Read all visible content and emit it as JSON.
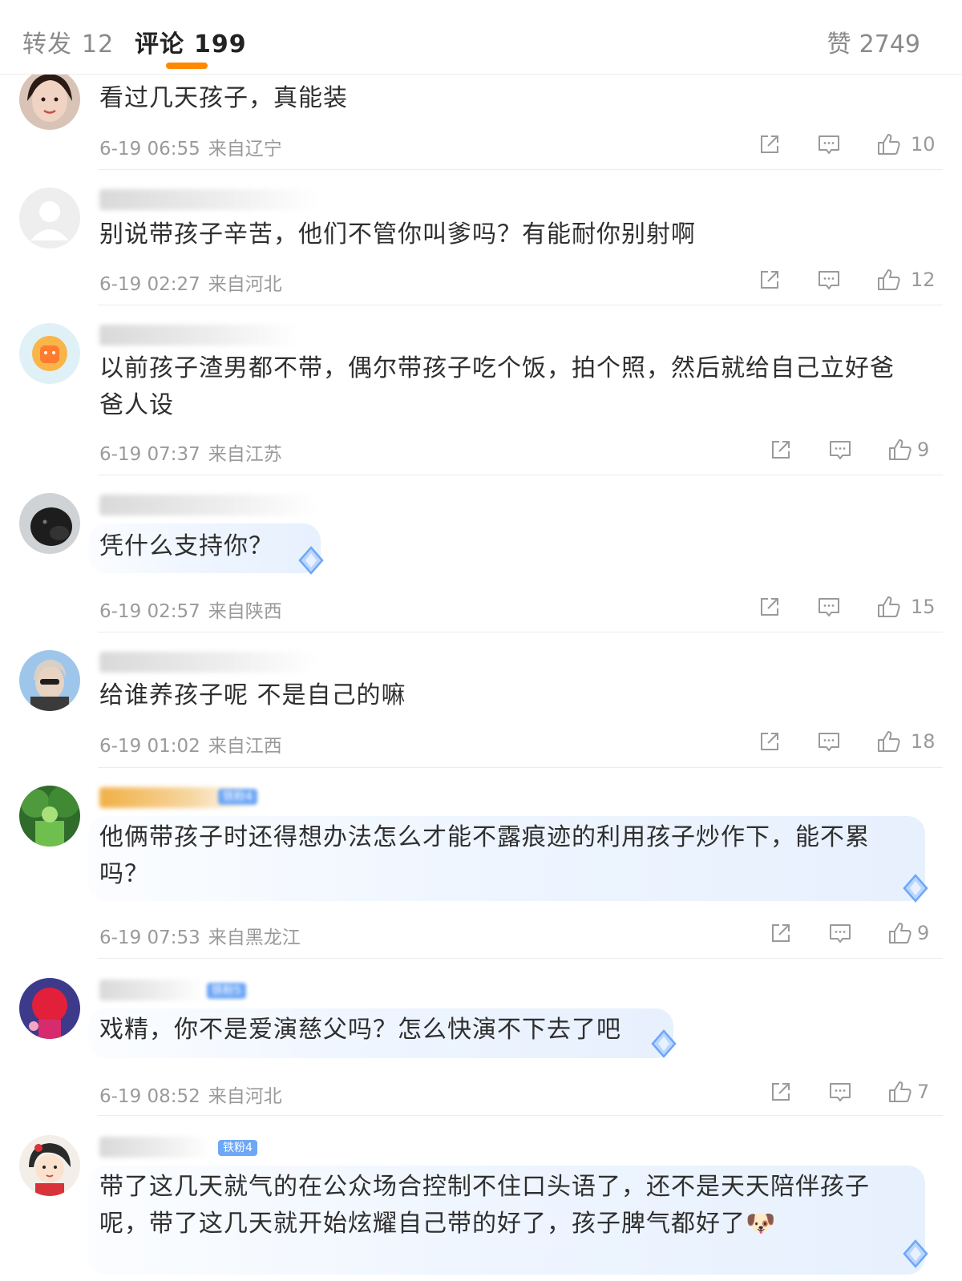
{
  "header": {
    "repost_label": "转发",
    "repost_count": "12",
    "comment_label": "评论",
    "comment_count": "199",
    "like_label": "赞",
    "like_count": "2749"
  },
  "colors": {
    "accent": "#ff8a00",
    "badge_blue": "#6ea7f5",
    "meta_gray": "#9a9a9a"
  },
  "comments": [
    {
      "username": "",
      "text": "看过几天孩子，真能装",
      "date": "6-19 06:55",
      "location": "来自辽宁",
      "likes": "10"
    },
    {
      "username": "",
      "text": "别说带孩子辛苦，他们不管你叫爹吗？有能耐你别射啊",
      "date": "6-19 02:27",
      "location": "来自河北",
      "likes": "12"
    },
    {
      "username": "",
      "text": "以前孩子渣男都不带，偶尔带孩子吃个饭，拍个照，然后就给自己立好爸爸人设",
      "date": "6-19 07:37",
      "location": "来自江苏",
      "likes": "9"
    },
    {
      "username": "",
      "text": "凭什么支持你？",
      "date": "6-19 02:57",
      "location": "来自陕西",
      "likes": "15"
    },
    {
      "username": "",
      "text": "给谁养孩子呢 不是自己的嘛",
      "date": "6-19 01:02",
      "location": "来自江西",
      "likes": "18"
    },
    {
      "username": "",
      "badge": "铁粉4",
      "text": "他俩带孩子时还得想办法怎么才能不露痕迹的利用孩子炒作下，能不累吗？",
      "date": "6-19 07:53",
      "location": "来自黑龙江",
      "likes": "9"
    },
    {
      "username": "",
      "badge": "铁粉5",
      "text": "戏精，你不是爱演慈父吗？怎么快演不下去了吧",
      "date": "6-19 08:52",
      "location": "来自河北",
      "likes": "7"
    },
    {
      "username": "",
      "badge": "铁粉4",
      "text": "带了这几天就气的在公众场合控制不住口头语了，还不是天天陪伴孩子呢，带了这几天就开始炫耀自己带的好了，孩子脾气都好了🐶"
    }
  ]
}
